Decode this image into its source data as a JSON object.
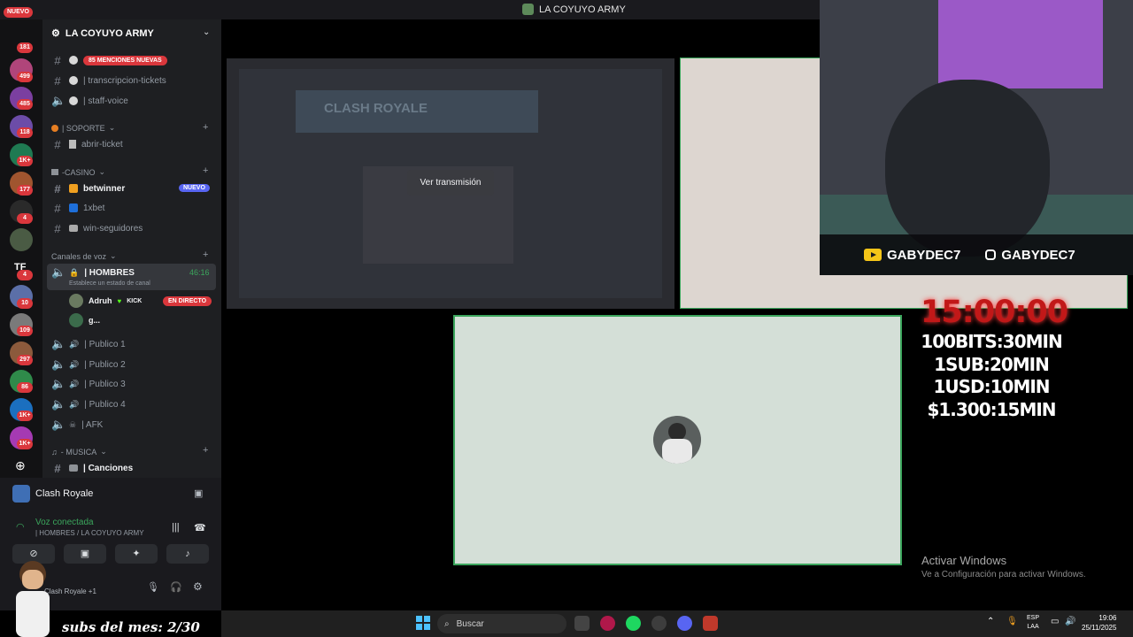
{
  "window": {
    "title": "LA COYUYO ARMY"
  },
  "server_rail": {
    "nuevo_label": "NUEVO",
    "badges": [
      "181",
      "499",
      "485",
      "118",
      "1K+",
      "177",
      "4",
      "4",
      "10",
      "109",
      "297",
      "86",
      "1K+",
      "1K+"
    ],
    "labels": [
      "TF"
    ]
  },
  "sidebar": {
    "server_name": "LA COYUYO ARMY",
    "mentions_pill": "85 MENCIONES NUEVAS",
    "channels_top": [
      {
        "name": "| transcripcion-tickets"
      },
      {
        "name": "| staff-voice"
      }
    ],
    "cat_soporte": "| SOPORTE",
    "ch_abrir": "abrir-ticket",
    "cat_casino": "-CASINO",
    "ch_betwinner": "betwinner",
    "nuevo_badge": "NUEVO",
    "ch_1xbet": "1xbet",
    "ch_winseg": "win-seguidores",
    "cat_voz": "Canales de voz",
    "voice_hombres": "| HOMBRES",
    "voice_time": "46:16",
    "voice_status": "Establece un estado de canal",
    "user1": "Adruh",
    "user1_tag": "KICK",
    "live_badge": "EN DIRECTO",
    "user2": "g...",
    "publicos": [
      "| Publico 1",
      "| Publico 2",
      "| Publico 3",
      "| Publico 4"
    ],
    "afk": "| AFK",
    "cat_musica": "- MUSICA",
    "ch_canciones": "| Canciones"
  },
  "user_panel": {
    "activity": "Clash Royale",
    "voice_connected": "Voz conectada",
    "voice_channel": "| HOMBRES / LA COYUYO ARMY",
    "status": "Clash Royale +1"
  },
  "stream": {
    "watch_button": "Ver transmisión",
    "preview_text": "CLASH ROYALE"
  },
  "overlay": {
    "youtube": "GABYDEC7",
    "instagram": "GABYDEC7",
    "timer": "15:00:00",
    "rates": [
      "100BITS:30MIN",
      "1SUB:20MIN",
      "1USD:10MIN",
      "$1.300:15MIN"
    ],
    "subs_text": "subs del mes: 2/30"
  },
  "windows": {
    "activate_title": "Activar Windows",
    "activate_sub": "Ve a Configuración para activar Windows."
  },
  "taskbar": {
    "search_placeholder": "Buscar",
    "lang": "ESP",
    "lang2": "LAA",
    "time": "19:06",
    "date": "25/11/2025"
  },
  "colors": {
    "accent_green": "#3ba55c",
    "mention_red": "#da373c",
    "blurple": "#5865f2",
    "timer_red": "#c11818"
  }
}
